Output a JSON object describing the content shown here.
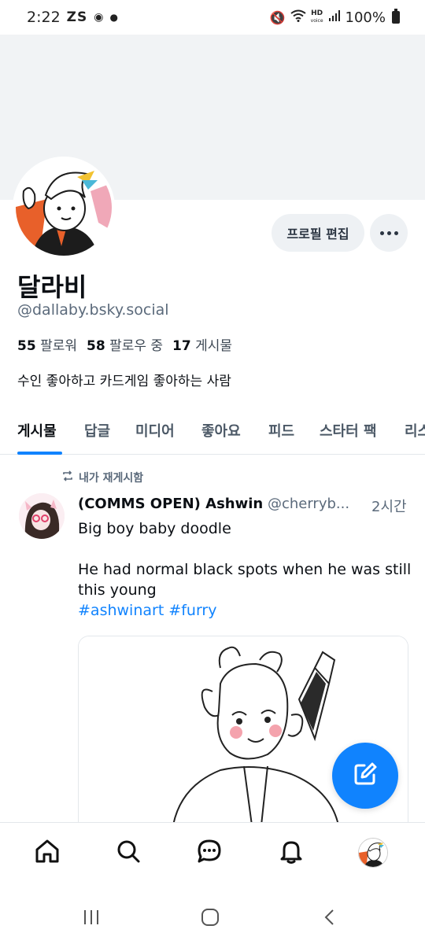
{
  "status_bar": {
    "time": "2:22",
    "notifications": "ZS",
    "hd_label": "HD",
    "voice_label": "voice",
    "battery": "100%"
  },
  "profile": {
    "display_name": "달라비",
    "handle": "@dallaby.bsky.social",
    "followers_count": "55",
    "followers_label": "팔로워",
    "following_count": "58",
    "following_label": "팔로우 중",
    "posts_count": "17",
    "posts_label": "게시물",
    "bio": "수인 좋아하고 카드게임 좋아하는 사람",
    "edit_button": "프로필 편집"
  },
  "tabs": [
    {
      "label": "게시물"
    },
    {
      "label": "답글"
    },
    {
      "label": "미디어"
    },
    {
      "label": "좋아요"
    },
    {
      "label": "피드"
    },
    {
      "label": "스타터 팩"
    },
    {
      "label": "리스"
    }
  ],
  "post": {
    "repost_label": "내가 재게시함",
    "author": "(COMMS OPEN) Ashwin",
    "handle": "@cherryb...",
    "time": "2시간",
    "line1": "Big boy baby doodle",
    "line2": "He had normal black spots when he was still this young",
    "hashtags": "#ashwinart #furry"
  },
  "colors": {
    "accent": "#1083fe",
    "banner": "#f1f3f5",
    "button_bg": "#eef1f4",
    "muted_text": "#5b6a7b"
  },
  "icons": {
    "bottom_nav": [
      "home-icon",
      "search-icon",
      "chat-icon",
      "bell-icon",
      "profile-avatar"
    ],
    "system_nav": [
      "recents-icon",
      "home-circle-icon",
      "back-icon"
    ],
    "fab": "compose-icon"
  }
}
